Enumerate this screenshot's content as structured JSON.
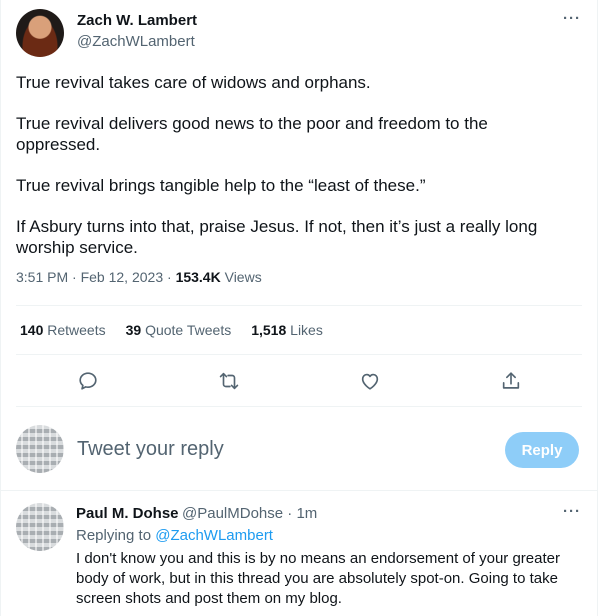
{
  "tweet": {
    "author_name": "Zach W. Lambert",
    "author_handle": "@ZachWLambert",
    "paragraphs": [
      "True revival takes care of widows and orphans.",
      "True revival delivers good news to the poor and freedom to the oppressed.",
      "True revival brings tangible help to the “least of these.”",
      "If Asbury turns into that, praise Jesus. If not, then it’s just a really long worship service."
    ],
    "time": "3:51 PM",
    "date": "Feb 12, 2023",
    "views_count": "153.4K",
    "views_label": "Views",
    "more_label": "···"
  },
  "stats": {
    "retweets_count": "140",
    "retweets_label": "Retweets",
    "quotes_count": "39",
    "quotes_label": "Quote Tweets",
    "likes_count": "1,518",
    "likes_label": "Likes"
  },
  "actions": [
    {
      "icon": "reply-icon"
    },
    {
      "icon": "retweet-icon"
    },
    {
      "icon": "like-icon"
    },
    {
      "icon": "share-icon"
    }
  ],
  "compose": {
    "placeholder": "Tweet your reply",
    "button_label": "Reply"
  },
  "reply": {
    "author_name": "Paul M. Dohse",
    "author_handle": "@PaulMDohse",
    "time": "1m",
    "replying_prefix": "Replying to",
    "replying_handle": "@ZachWLambert",
    "text": "I don't know you and this is by no means an endorsement of your greater body of work, but in this thread you are absolutely spot-on.  Going to take screen shots and post them on my blog.",
    "more_label": "···"
  },
  "colors": {
    "accent": "#1d9bf0",
    "muted": "#536471",
    "reply_button_disabled": "#8ecdf8"
  }
}
